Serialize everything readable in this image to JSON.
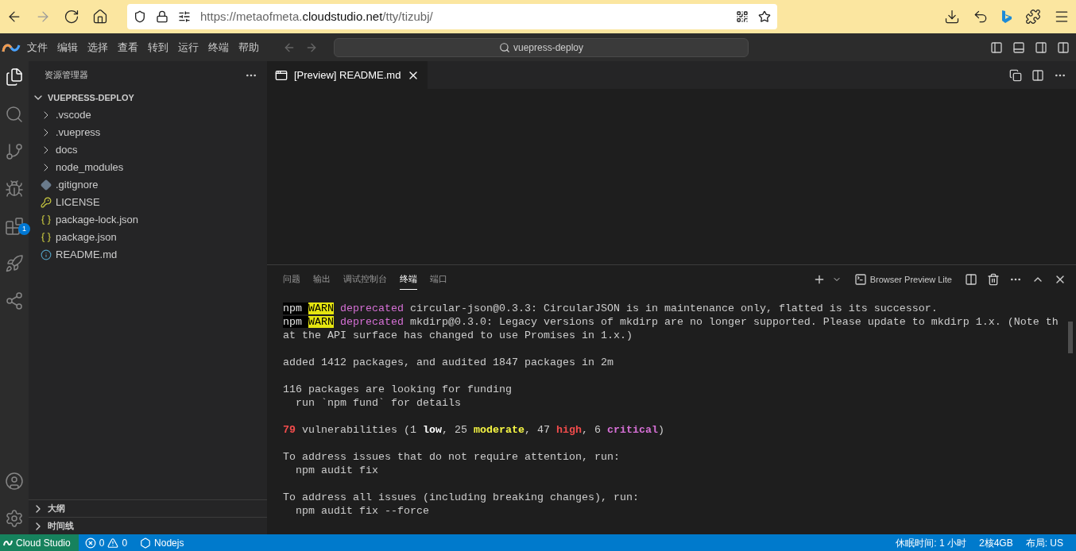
{
  "browser": {
    "url": {
      "prefix": "https://metaofmeta.",
      "domain": "cloudstudio.net",
      "path": "/tty/tizubj/"
    }
  },
  "menu": [
    "文件",
    "编辑",
    "选择",
    "查看",
    "转到",
    "运行",
    "终端",
    "帮助"
  ],
  "command_center": {
    "label": "vuepress-deploy"
  },
  "activity_bar": {
    "extensions_badge": "1"
  },
  "sidebar": {
    "title": "资源管理器",
    "section": {
      "label": "VUEPRESS-DEPLOY",
      "expanded": true
    },
    "items": [
      {
        "name": ".vscode",
        "kind": "folder"
      },
      {
        "name": ".vuepress",
        "kind": "folder"
      },
      {
        "name": "docs",
        "kind": "folder"
      },
      {
        "name": "node_modules",
        "kind": "folder"
      },
      {
        "name": ".gitignore",
        "kind": "git"
      },
      {
        "name": "LICENSE",
        "kind": "license"
      },
      {
        "name": "package-lock.json",
        "kind": "json"
      },
      {
        "name": "package.json",
        "kind": "json"
      },
      {
        "name": "README.md",
        "kind": "info"
      }
    ],
    "bottom_sections": [
      {
        "label": "大纲",
        "expanded": false
      },
      {
        "label": "时间线",
        "expanded": false
      }
    ]
  },
  "editor_tabs": [
    {
      "label": "[Preview] README.md",
      "selected": true
    }
  ],
  "panel": {
    "tabs": [
      {
        "label": "问题",
        "selected": false
      },
      {
        "label": "输出",
        "selected": false
      },
      {
        "label": "调试控制台",
        "selected": false
      },
      {
        "label": "终端",
        "selected": true
      },
      {
        "label": "端口",
        "selected": false
      }
    ],
    "terminal_label": "Browser Preview Lite",
    "blocks": [
      [
        [
          {
            "kind": "npm",
            "text": "npm "
          },
          {
            "kind": "warn",
            "text": "WARN"
          },
          {
            "kind": "deprecated",
            "text": " deprecated"
          },
          {
            "kind": "plain",
            "text": " circular-json@0.3.3: CircularJSON is in maintenance only, flatted is its successor."
          }
        ],
        [
          {
            "kind": "npm",
            "text": "npm "
          },
          {
            "kind": "warn",
            "text": "WARN"
          },
          {
            "kind": "deprecated",
            "text": " deprecated"
          },
          {
            "kind": "plain",
            "text": " mkdirp@0.3.0: Legacy versions of mkdirp are no longer supported. Please update to mkdirp 1.x. (Note th"
          }
        ],
        [
          {
            "kind": "plain",
            "text": "at the API surface has changed to use Promises in 1.x.)"
          }
        ]
      ],
      [
        [
          {
            "kind": "plain",
            "text": "added 1412 packages, and audited 1847 packages in 2m"
          }
        ]
      ],
      [
        [
          {
            "kind": "plain",
            "text": "116 packages are looking for funding"
          }
        ],
        [
          {
            "kind": "plain",
            "text": "  run `npm fund` for details"
          }
        ]
      ],
      [
        [
          {
            "kind": "red-bold",
            "text": "79"
          },
          {
            "kind": "plain",
            "text": " vulnerabilities (1 "
          },
          {
            "kind": "bold",
            "text": "low"
          },
          {
            "kind": "plain",
            "text": ", 25 "
          },
          {
            "kind": "yellow-bold",
            "text": "moderate"
          },
          {
            "kind": "plain",
            "text": ", 47 "
          },
          {
            "kind": "red-bold",
            "text": "high"
          },
          {
            "kind": "plain",
            "text": ", 6 "
          },
          {
            "kind": "magenta-bold",
            "text": "critical"
          },
          {
            "kind": "plain",
            "text": ")"
          }
        ]
      ],
      [
        [
          {
            "kind": "plain",
            "text": "To address issues that do not require attention, run:"
          }
        ],
        [
          {
            "kind": "plain",
            "text": "  npm audit fix"
          }
        ]
      ],
      [
        [
          {
            "kind": "plain",
            "text": "To address all issues (including breaking changes), run:"
          }
        ],
        [
          {
            "kind": "plain",
            "text": "  npm audit fix --force"
          }
        ]
      ]
    ]
  },
  "status_bar": {
    "remote": "Cloud Studio",
    "errors": "0",
    "warnings": "0",
    "runtime": "Nodejs",
    "right": [
      "休眠时间: 1 小时",
      "2核4GB",
      "布局: US"
    ]
  }
}
